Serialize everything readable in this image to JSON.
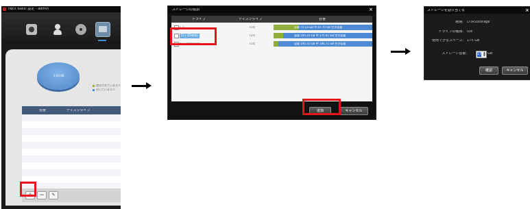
{
  "window1": {
    "title": "INEX Basic 設定 - admin",
    "toolbar": {
      "icons": [
        "camera-icon",
        "user-icon",
        "disc-icon",
        "storage-icon"
      ],
      "active": "storage"
    },
    "pie_label": "0.03 KB",
    "legend": [
      {
        "label": "使用されているスペ",
        "color": "#8fae3c"
      },
      {
        "label": "空いているスペ",
        "color": "#4d8ad6"
      }
    ],
    "list_header": {
      "col1": "容量",
      "col2": "ディスクタイプ"
    },
    "add_button": "+",
    "remove_button": "−",
    "edit_button": "✎"
  },
  "window2": {
    "title": "ストレージの追加",
    "columns": {
      "drive": "ドライブ",
      "disk_type": "ディスクタイプ",
      "capacity": "容量"
    },
    "rows": [
      {
        "drive": "C:\\",
        "disk_type": "IDE",
        "capacity": "容量 75.13 GB 中 47.75 GB 空き容量",
        "used_fraction": 0.25,
        "selected": false
      },
      {
        "drive": "D:\\ (Data)",
        "disk_type": "IDE",
        "capacity": "容量 195.31 GB 中 175.61 GB 空き容量",
        "used_fraction": 0.1,
        "selected": true
      },
      {
        "drive": "E:\\ (Backup)",
        "disk_type": "IDE",
        "capacity": "容量 195.31 GB 中 194.71 GB 空き容量",
        "used_fraction": 0.05,
        "selected": false
      }
    ],
    "add_button": "追加",
    "cancel_button": "キャンセル",
    "close": "×"
  },
  "window3": {
    "title": "ストレージを割り当てる",
    "path_label": "経路:",
    "path_value": "D:\\RSStorage",
    "drive_type_label": "ドライブの種類:",
    "drive_type_value": "IDE",
    "available_label": "使用できるスペース:",
    "available_value": "175 GB",
    "storage_capacity_label": "ストレージ容量:",
    "storage_capacity_value": "175",
    "unit": "GB",
    "ok_button": "確認",
    "cancel_button": "キャンセル",
    "close": "×"
  },
  "colors": {
    "highlight": "#e8141c",
    "used": "#8fae3c",
    "free": "#4d8ad6"
  }
}
